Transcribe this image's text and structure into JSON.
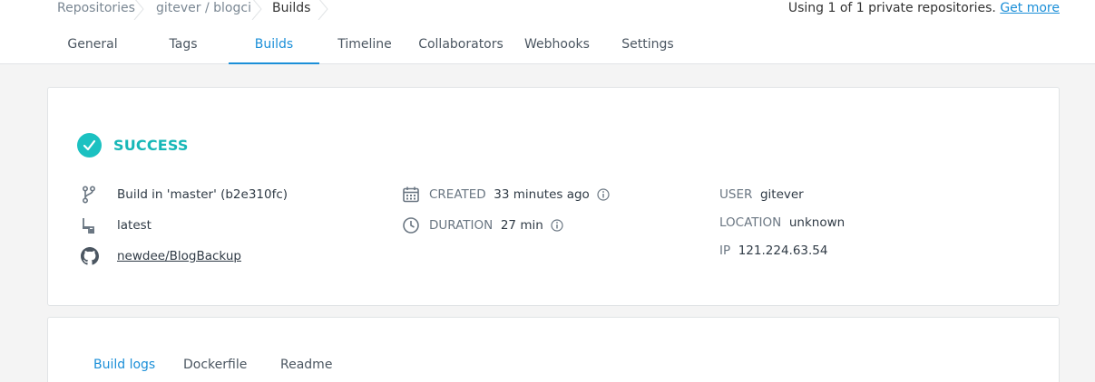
{
  "breadcrumb": {
    "items": [
      "Repositories",
      "gitever / blogci",
      "Builds"
    ]
  },
  "usage": {
    "text": "Using 1 of 1 private repositories.",
    "link": "Get more"
  },
  "tabs": [
    "General",
    "Tags",
    "Builds",
    "Timeline",
    "Collaborators",
    "Webhooks",
    "Settings"
  ],
  "build": {
    "status": "SUCCESS",
    "branch": "Build in 'master' (b2e310fc)",
    "tag": "latest",
    "repo": "newdee/BlogBackup",
    "created_label": "CREATED",
    "created_value": "33 minutes ago",
    "duration_label": "DURATION",
    "duration_value": "27 min",
    "user_label": "USER",
    "user_value": "gitever",
    "location_label": "LOCATION",
    "location_value": "unknown",
    "ip_label": "IP",
    "ip_value": "121.224.63.54"
  },
  "subtabs": [
    "Build logs",
    "Dockerfile",
    "Readme"
  ],
  "colors": {
    "accent": "#1b8fd8",
    "success": "#1bc1c1"
  },
  "icons": [
    "branch-icon",
    "tag-icon",
    "github-icon",
    "calendar-icon",
    "clock-icon",
    "info-icon",
    "check-icon",
    "chevron-right-icon"
  ]
}
